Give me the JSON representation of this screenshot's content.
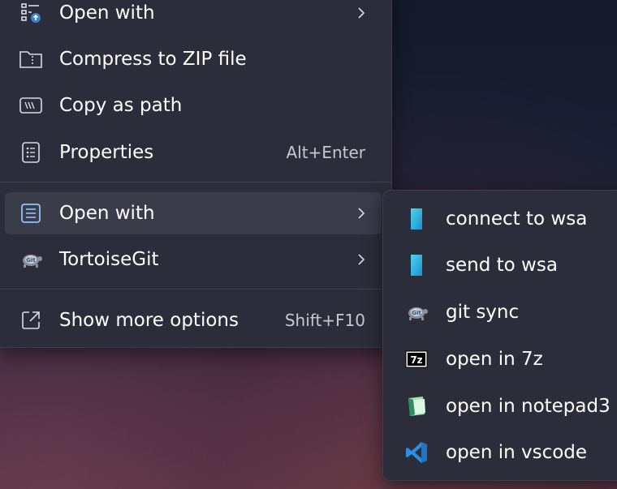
{
  "context_menu": {
    "items": [
      {
        "label": "Open with",
        "icon": "open-with-icon",
        "has_submenu": true
      },
      {
        "label": "Compress to ZIP file",
        "icon": "zip-folder-icon"
      },
      {
        "label": "Copy as path",
        "icon": "copy-path-icon"
      },
      {
        "label": "Properties",
        "icon": "properties-icon",
        "shortcut": "Alt+Enter"
      },
      {
        "label": "Open with",
        "icon": "document-lines-icon",
        "has_submenu": true,
        "highlighted": true
      },
      {
        "label": "TortoiseGit",
        "icon": "tortoisegit-icon",
        "has_submenu": true
      },
      {
        "label": "Show more options",
        "icon": "external-link-icon",
        "shortcut": "Shift+F10"
      }
    ]
  },
  "submenu": {
    "items": [
      {
        "label": "connect to wsa",
        "icon": "wsa-icon"
      },
      {
        "label": "send to wsa",
        "icon": "wsa-icon"
      },
      {
        "label": "git sync",
        "icon": "tortoisegit-icon"
      },
      {
        "label": "open in 7z",
        "icon": "7zip-icon"
      },
      {
        "label": "open in notepad3",
        "icon": "notepad3-icon"
      },
      {
        "label": "open in vscode",
        "icon": "vscode-icon"
      }
    ]
  },
  "colors": {
    "menu_bg": "#2b2d3a",
    "highlight": "#3a3c4a",
    "accent": "#3b82d6"
  }
}
